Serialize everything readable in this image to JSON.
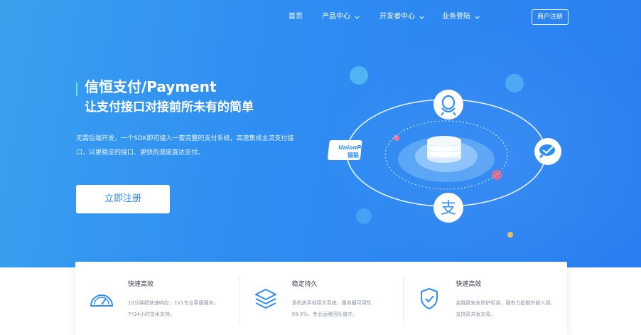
{
  "nav": {
    "items": [
      {
        "label": "首页",
        "has_dropdown": false
      },
      {
        "label": "产品中心",
        "has_dropdown": true
      },
      {
        "label": "开发者中心",
        "has_dropdown": true
      },
      {
        "label": "业务登陆",
        "has_dropdown": true
      }
    ],
    "register_label": "商户注册"
  },
  "hero": {
    "title": "信恒支付/Payment",
    "subtitle": "让支付接口对接前所未有的简单",
    "description": "无需后端开发，一个SDK即可接入一套完整的支付系统，高速集成主流支付接口，以更稳定的接口、更快的速度直达支付。",
    "cta_label": "立即注册",
    "accent_color": "#6ee0d6",
    "background_color": "#2f8ef2"
  },
  "illustration": {
    "icons": [
      "qq-icon",
      "wechat-pay-icon",
      "alipay-icon",
      "unionpay-icon",
      "coin-stack-icon"
    ],
    "unionpay_text": "UnionPay",
    "unionpay_cn": "银联",
    "alipay_char": "支"
  },
  "features": [
    {
      "icon": "gauge-icon",
      "title": "快速高效",
      "description": "10分钟超快速响应，1V1专业客服服务，7*24小时技术支持。"
    },
    {
      "icon": "layers-icon",
      "title": "稳定持久",
      "description": "多机房异地容灾系统，服务器可用性99.9%，专业运维团队值守。"
    },
    {
      "icon": "shield-check-icon",
      "title": "快速高效",
      "description": "金融级安全防护标准，强有力抵御外部入侵，支持高并发交易。"
    }
  ]
}
